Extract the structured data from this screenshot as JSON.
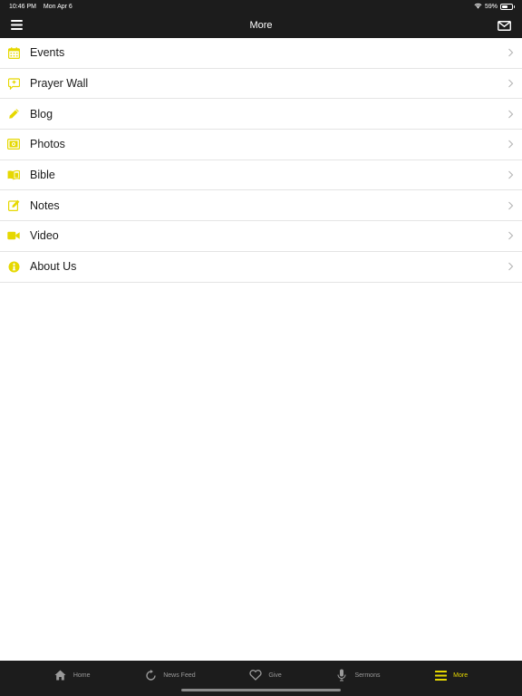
{
  "status_bar": {
    "time": "10:46 PM",
    "date": "Mon Apr 6",
    "battery": "59%",
    "battery_level": 0.59
  },
  "nav": {
    "title": "More",
    "left_icon": "hamburger-icon",
    "right_icon": "mail-icon"
  },
  "colors": {
    "accent": "#e6d800",
    "bar_background": "#1c1c1c",
    "inactive_tab": "#9a9a9a"
  },
  "menu": [
    {
      "label": "Events",
      "icon": "calendar-icon"
    },
    {
      "label": "Prayer Wall",
      "icon": "prayer-bubble-icon"
    },
    {
      "label": "Blog",
      "icon": "pencil-icon"
    },
    {
      "label": "Photos",
      "icon": "photo-icon"
    },
    {
      "label": "Bible",
      "icon": "book-icon"
    },
    {
      "label": "Notes",
      "icon": "note-edit-icon"
    },
    {
      "label": "Video",
      "icon": "video-camera-icon"
    },
    {
      "label": "About Us",
      "icon": "info-icon"
    }
  ],
  "tabs": [
    {
      "label": "Home",
      "icon": "home-icon",
      "active": false
    },
    {
      "label": "News Feed",
      "icon": "refresh-icon",
      "active": false
    },
    {
      "label": "Give",
      "icon": "heart-icon",
      "active": false
    },
    {
      "label": "Sermons",
      "icon": "microphone-icon",
      "active": false
    },
    {
      "label": "More",
      "icon": "menu-lines-icon",
      "active": true
    }
  ]
}
